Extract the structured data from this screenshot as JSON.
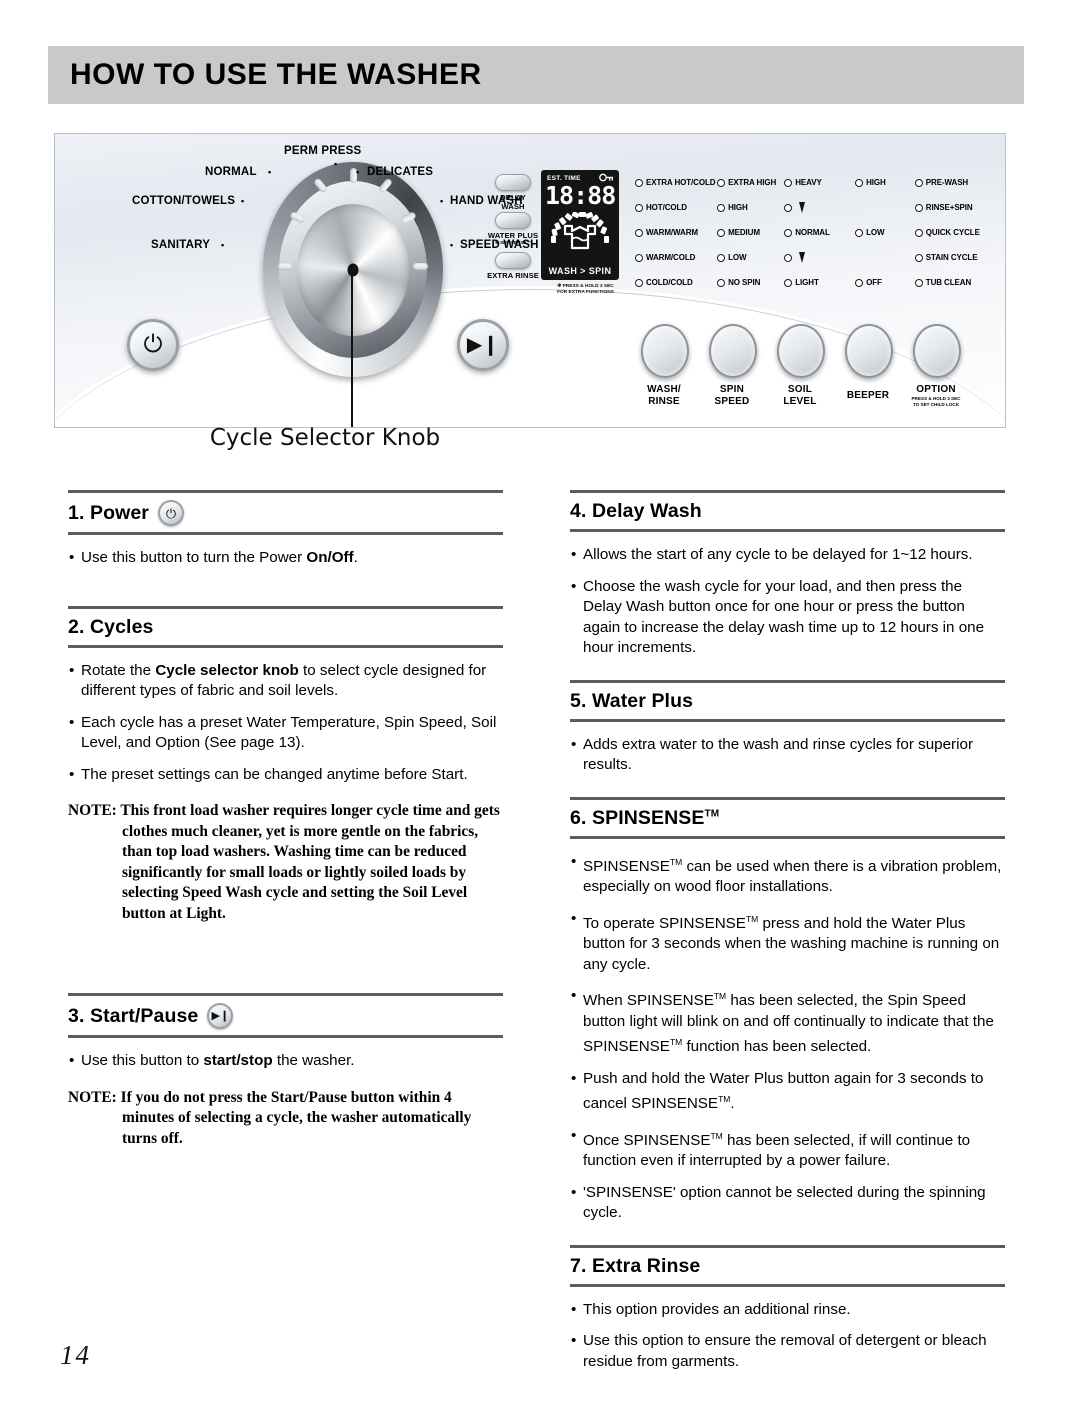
{
  "header": {
    "title": "HOW TO USE THE WASHER"
  },
  "page_number": "14",
  "panel": {
    "knob_caption": "Cycle Selector Knob",
    "cycle_labels": [
      {
        "label": "PERM PRESS"
      },
      {
        "label": "NORMAL"
      },
      {
        "label": "DELICATES"
      },
      {
        "label": "COTTON/TOWELS"
      },
      {
        "label": "HAND WASH"
      },
      {
        "label": "SANITARY"
      },
      {
        "label": "SPEED WASH"
      }
    ],
    "side_buttons": [
      {
        "label": "DELAY\nWASH",
        "line1": "DELAY",
        "line2": "WASH",
        "sub": ""
      },
      {
        "label": "WATER PLUS",
        "line1": "WATER PLUS",
        "line2": "",
        "sub": "✻ SPINSENSE™"
      },
      {
        "label": "EXTRA RINSE",
        "line1": "EXTRA RINSE",
        "line2": "",
        "sub": ""
      }
    ],
    "display": {
      "est_time_label": "EST. TIME",
      "key_icon": "key-icon",
      "digits": "18:88",
      "bottom_left": "WASH",
      "bottom_sep": ">",
      "bottom_right": "SPIN",
      "footnote_line1": "✻ PRESS & HOLD 3 SEC",
      "footnote_line2": "FOR EXTRA FUNCTIONS"
    },
    "indicator_columns": [
      "Wash/Rinse",
      "Spin Speed",
      "Soil Level",
      "Beeper",
      "Option"
    ],
    "indicator_rows": [
      {
        "c0": "EXTRA HOT/COLD",
        "c1": "EXTRA HIGH",
        "c2": "HEAVY",
        "c3": "HIGH",
        "c4": "PRE-WASH"
      },
      {
        "c0": "HOT/COLD",
        "c1": "HIGH",
        "c2": "",
        "c3": "",
        "c4": "RINSE+SPIN"
      },
      {
        "c0": "WARM/WARM",
        "c1": "MEDIUM",
        "c2": "NORMAL",
        "c3": "LOW",
        "c4": "QUICK CYCLE"
      },
      {
        "c0": "WARM/COLD",
        "c1": "LOW",
        "c2": "",
        "c3": "",
        "c4": "STAIN CYCLE"
      },
      {
        "c0": "COLD/COLD",
        "c1": "NO SPIN",
        "c2": "LIGHT",
        "c3": "OFF",
        "c4": "TUB CLEAN"
      }
    ],
    "round_buttons": [
      {
        "line1": "WASH/",
        "line2": "RINSE",
        "sub1": "",
        "sub2": ""
      },
      {
        "line1": "SPIN",
        "line2": "SPEED",
        "sub1": "",
        "sub2": ""
      },
      {
        "line1": "SOIL",
        "line2": "LEVEL",
        "sub1": "",
        "sub2": ""
      },
      {
        "line1": "BEEPER",
        "line2": "",
        "sub1": "",
        "sub2": ""
      },
      {
        "line1": "OPTION",
        "line2": "",
        "sub1": "PRESS & HOLD 3 SEC",
        "sub2": "TO SET CHILD LOCK"
      }
    ],
    "power_button_glyph": "⏻",
    "start_button_glyph": "▶❙"
  },
  "sections": {
    "power": {
      "heading": "1. Power",
      "icon": "power-icon",
      "bullets": [
        {
          "pre": "Use this button to turn the Power ",
          "bold": "On/Off",
          "post": "."
        }
      ]
    },
    "cycles": {
      "heading": "2. Cycles",
      "b1_pre": "Rotate the ",
      "b1_bold": "Cycle selector knob",
      "b1_post": "  to select cycle designed for different types of fabric and soil levels.",
      "b2": "Each cycle has a preset Water Temperature, Spin Speed, Soil Level, and Option (See page 13).",
      "b3": "The preset settings can be changed anytime before Start.",
      "note_label": "NOTE:",
      "note_text": "This front load washer requires longer cycle time and gets clothes much cleaner, yet is more gentle on the fabrics, than top load washers. Washing time can be reduced significantly for small loads or lightly soiled loads by selecting Speed Wash cycle and setting the Soil Level button at Light."
    },
    "start_pause": {
      "heading": "3. Start/Pause",
      "icon": "start-pause-icon",
      "b1_pre": "Use this button to ",
      "b1_bold": "start/stop",
      "b1_post": " the washer.",
      "note_label": "NOTE:",
      "note_text": "If you do not press the Start/Pause button within 4 minutes of selecting a cycle, the washer automatically turns off."
    },
    "delay_wash": {
      "heading": "4. Delay Wash",
      "b1": "Allows the start of any cycle to be delayed for 1~12 hours.",
      "b2": "Choose the wash cycle for your load,  and then press the Delay Wash button once for one hour or press the button again to increase the delay wash time up to 12 hours in one hour increments."
    },
    "water_plus": {
      "heading": "5. Water Plus",
      "b1": "Adds extra water to the wash and rinse cycles for superior results."
    },
    "spinsense": {
      "heading": "6. SPINSENSE",
      "heading_tm": "TM",
      "b1_a": "SPINSENSE",
      "b1_b": " can be used when there is a vibration problem, especially on wood floor installations.",
      "b2_a": "To operate SPINSENSE",
      "b2_b": " press and hold the Water Plus button for 3 seconds when the washing machine is running on any cycle.",
      "b3_a": "When SPINSENSE",
      "b3_b": " has been selected, the Spin Speed button light will blink on and off continually to indicate that the SPINSENSE",
      "b3_c": " function has been selected.",
      "b4_a": "Push and hold the Water Plus button again for 3 seconds to cancel SPINSENSE",
      "b4_b": ".",
      "b5_a": "Once SPINSENSE",
      "b5_b": " has been selected, if will continue to function even if interrupted by a power failure.",
      "b6": "'SPINSENSE' option cannot be selected during the spinning cycle."
    },
    "extra_rinse": {
      "heading": "7. Extra Rinse",
      "b1": "This option provides an additional rinse.",
      "b2": "Use this option to ensure the removal of detergent or bleach residue from garments."
    }
  }
}
